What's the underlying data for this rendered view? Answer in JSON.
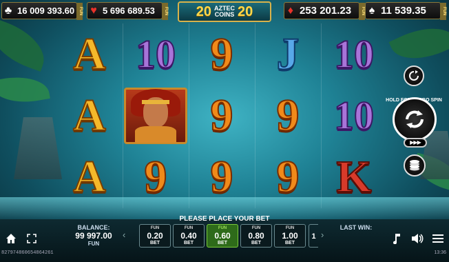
{
  "top_bar": {
    "clubs_jackpot": "16 009 393.60",
    "hearts_jackpot": "5 696 689.53",
    "diamonds_jackpot": "253 201.23",
    "spades_jackpot": "11 539.35",
    "fun_tag": "FUN",
    "logo_number": "20",
    "logo_text_1": "AZTEC",
    "logo_text_2": "COINS"
  },
  "reels": {
    "row1": [
      "A",
      "10",
      "9",
      "J",
      "10"
    ],
    "row2": [
      "A",
      "WARRIOR",
      "9",
      "9",
      "10"
    ],
    "row3": [
      "A",
      "9",
      "9",
      "9",
      "K"
    ]
  },
  "controls": {
    "turbo_hint": "HOLD FOR TURBO SPIN",
    "autoplay_label": "▶▶▶"
  },
  "bottom_bar": {
    "place_bet": "PLEASE PLACE YOUR BET",
    "balance_label": "BALANCE:",
    "balance_value": "99 997.00",
    "balance_currency": "FUN",
    "last_win_label": "LAST WIN:",
    "bets": [
      {
        "fun": "FUN",
        "value": "0.20",
        "bet": "BET"
      },
      {
        "fun": "FUN",
        "value": "0.40",
        "bet": "BET"
      },
      {
        "fun": "FUN",
        "value": "0.60",
        "bet": "BET"
      },
      {
        "fun": "FUN",
        "value": "0.80",
        "bet": "BET"
      },
      {
        "fun": "FUN",
        "value": "1.00",
        "bet": "BET"
      }
    ],
    "bet_partial": "1",
    "selected_bet_index": 2
  },
  "footer": {
    "session_id": "827974860654864261",
    "time": "13:36"
  },
  "colors": {
    "accent_gold": "#d9b24a",
    "selected_bet": "#2e6b1a",
    "clubs_suit": "#ffffff",
    "hearts_suit": "#e8322a",
    "diamonds_suit": "#e8322a",
    "spades_suit": "#ffffff"
  }
}
